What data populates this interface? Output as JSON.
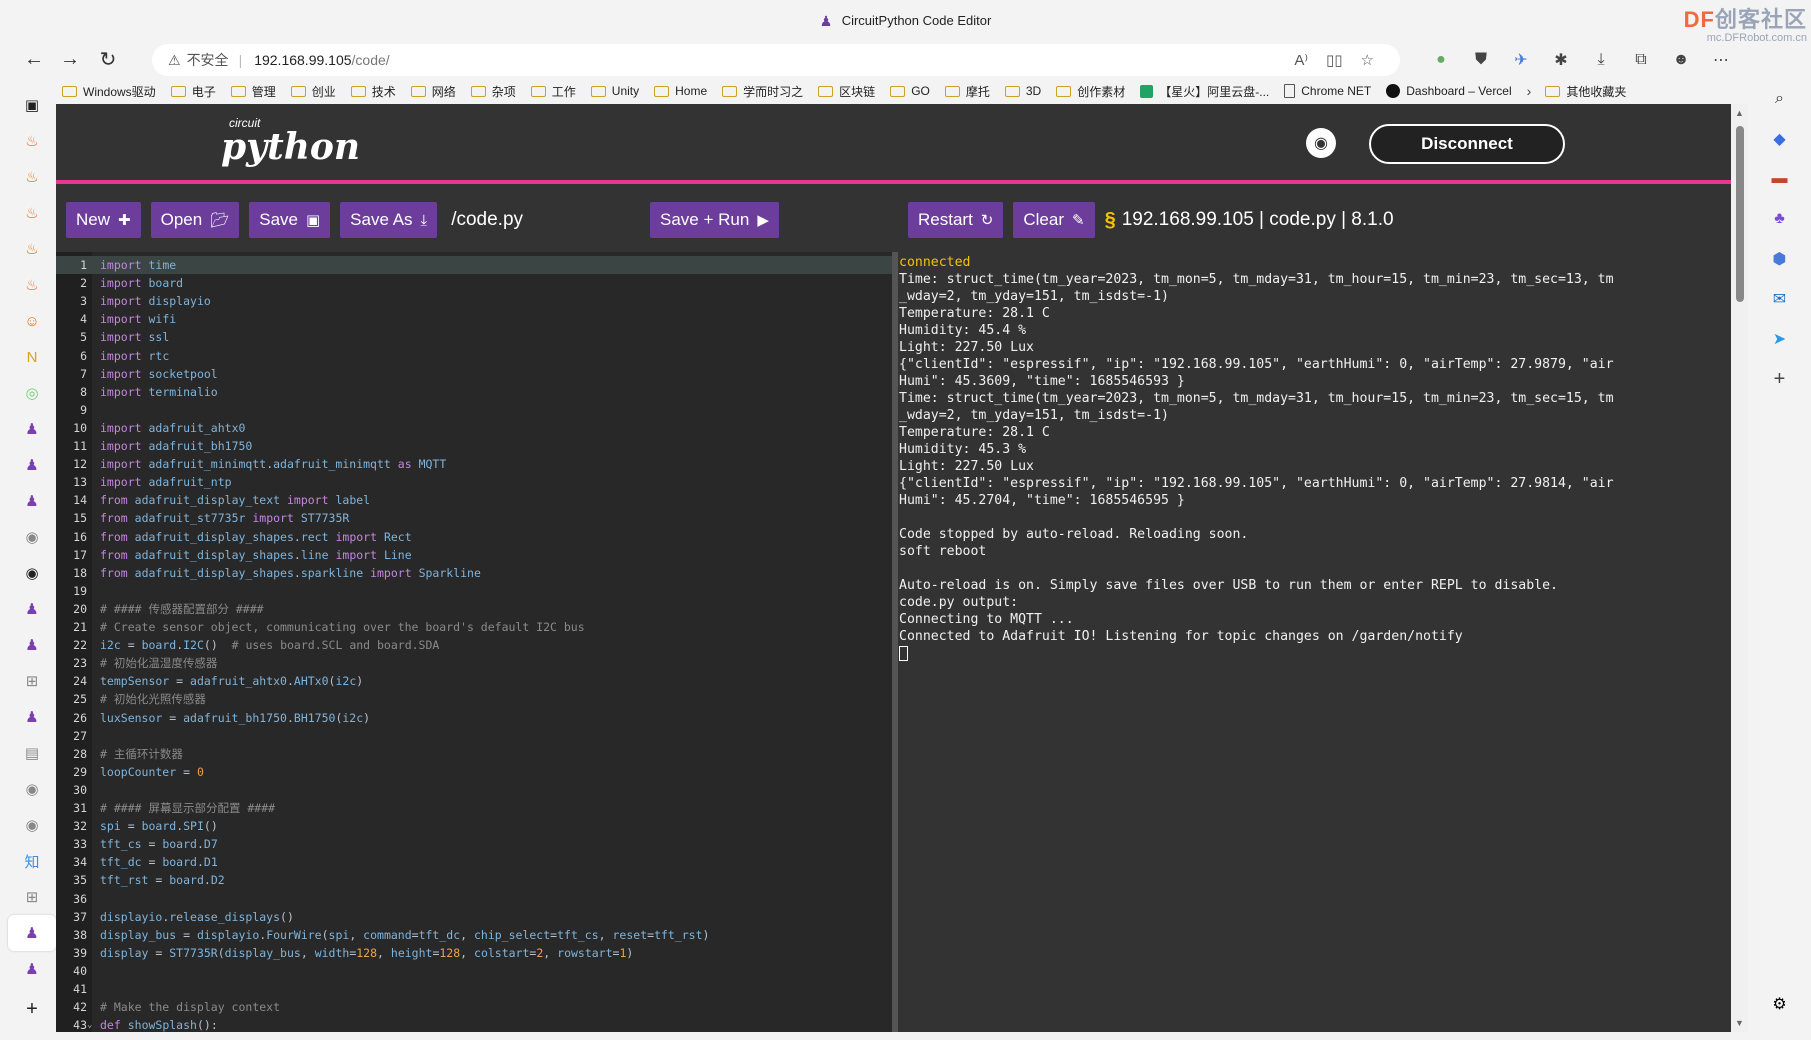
{
  "window": {
    "title": "CircuitPython Code Editor",
    "watermark_title_prefix": "DF",
    "watermark_title": "创客社区",
    "watermark_url": "mc.DFRobot.com.cn"
  },
  "addressbar": {
    "insecure_label": "不安全",
    "url_host": "192.168.99.105",
    "url_path": "/code/"
  },
  "bookmarks": [
    {
      "label": "Windows驱动",
      "icon": "folder"
    },
    {
      "label": "电子",
      "icon": "folder"
    },
    {
      "label": "管理",
      "icon": "folder"
    },
    {
      "label": "创业",
      "icon": "folder"
    },
    {
      "label": "技术",
      "icon": "folder"
    },
    {
      "label": "网络",
      "icon": "folder"
    },
    {
      "label": "杂项",
      "icon": "folder"
    },
    {
      "label": "工作",
      "icon": "folder"
    },
    {
      "label": "Unity",
      "icon": "folder"
    },
    {
      "label": "Home",
      "icon": "folder"
    },
    {
      "label": "学而时习之",
      "icon": "folder"
    },
    {
      "label": "区块链",
      "icon": "folder"
    },
    {
      "label": "GO",
      "icon": "folder"
    },
    {
      "label": "摩托",
      "icon": "folder"
    },
    {
      "label": "3D",
      "icon": "folder"
    },
    {
      "label": "创作素材",
      "icon": "folder"
    },
    {
      "label": "【星火】阿里云盘-...",
      "icon": "green"
    },
    {
      "label": "Chrome NET",
      "icon": "page"
    },
    {
      "label": "Dashboard – Vercel",
      "icon": "vercel"
    }
  ],
  "bookmarks_other": "其他收藏夹",
  "header": {
    "logo_small": "circuit",
    "logo_big": "python",
    "disconnect_label": "Disconnect"
  },
  "toolbar": {
    "new_label": "New",
    "open_label": "Open",
    "save_label": "Save",
    "save_as_label": "Save As",
    "filename": "/code.py",
    "save_run_label": "Save + Run",
    "restart_label": "Restart",
    "clear_label": "Clear",
    "connection_info": "192.168.99.105 | code.py | 8.1.0"
  },
  "editor": {
    "lines": [
      {
        "n": "1",
        "code": "import time"
      },
      {
        "n": "2",
        "code": "import board"
      },
      {
        "n": "3",
        "code": "import displayio"
      },
      {
        "n": "4",
        "code": "import wifi"
      },
      {
        "n": "5",
        "code": "import ssl"
      },
      {
        "n": "6",
        "code": "import rtc"
      },
      {
        "n": "7",
        "code": "import socketpool"
      },
      {
        "n": "8",
        "code": "import terminalio"
      },
      {
        "n": "9",
        "code": ""
      },
      {
        "n": "10",
        "code": "import adafruit_ahtx0"
      },
      {
        "n": "11",
        "code": "import adafruit_bh1750"
      },
      {
        "n": "12",
        "code": "import adafruit_minimqtt.adafruit_minimqtt as MQTT"
      },
      {
        "n": "13",
        "code": "import adafruit_ntp"
      },
      {
        "n": "14",
        "code": "from adafruit_display_text import label"
      },
      {
        "n": "15",
        "code": "from adafruit_st7735r import ST7735R"
      },
      {
        "n": "16",
        "code": "from adafruit_display_shapes.rect import Rect"
      },
      {
        "n": "17",
        "code": "from adafruit_display_shapes.line import Line"
      },
      {
        "n": "18",
        "code": "from adafruit_display_shapes.sparkline import Sparkline"
      },
      {
        "n": "19",
        "code": ""
      },
      {
        "n": "20",
        "code": "# #### 传感器配置部分 ####"
      },
      {
        "n": "21",
        "code": "# Create sensor object, communicating over the board's default I2C bus"
      },
      {
        "n": "22",
        "code": "i2c = board.I2C()  # uses board.SCL and board.SDA"
      },
      {
        "n": "23",
        "code": "# 初始化温湿度传感器"
      },
      {
        "n": "24",
        "code": "tempSensor = adafruit_ahtx0.AHTx0(i2c)"
      },
      {
        "n": "25",
        "code": "# 初始化光照传感器"
      },
      {
        "n": "26",
        "code": "luxSensor = adafruit_bh1750.BH1750(i2c)"
      },
      {
        "n": "27",
        "code": ""
      },
      {
        "n": "28",
        "code": "# 主循环计数器"
      },
      {
        "n": "29",
        "code": "loopCounter = 0"
      },
      {
        "n": "30",
        "code": ""
      },
      {
        "n": "31",
        "code": "# #### 屏幕显示部分配置 ####"
      },
      {
        "n": "32",
        "code": "spi = board.SPI()"
      },
      {
        "n": "33",
        "code": "tft_cs = board.D7"
      },
      {
        "n": "34",
        "code": "tft_dc = board.D1"
      },
      {
        "n": "35",
        "code": "tft_rst = board.D2"
      },
      {
        "n": "36",
        "code": ""
      },
      {
        "n": "37",
        "code": "displayio.release_displays()"
      },
      {
        "n": "38",
        "code": "display_bus = displayio.FourWire(spi, command=tft_dc, chip_select=tft_cs, reset=tft_rst)"
      },
      {
        "n": "39",
        "code": "display = ST7735R(display_bus, width=128, height=128, colstart=2, rowstart=1)"
      },
      {
        "n": "40",
        "code": ""
      },
      {
        "n": "41",
        "code": ""
      },
      {
        "n": "42",
        "code": "# Make the display context"
      },
      {
        "n": "43",
        "code": "def showSplash():"
      }
    ]
  },
  "serial": {
    "lines": [
      "connected",
      "Time: struct_time(tm_year=2023, tm_mon=5, tm_mday=31, tm_hour=15, tm_min=23, tm_sec=13, tm",
      "_wday=2, tm_yday=151, tm_isdst=-1)",
      "Temperature: 28.1 C",
      "Humidity: 45.4 %",
      "Light: 227.50 Lux",
      "{\"clientId\": \"espressif\", \"ip\": \"192.168.99.105\", \"earthHumi\": 0, \"airTemp\": 27.9879, \"air",
      "Humi\": 45.3609, \"time\": 1685546593 }",
      "Time: struct_time(tm_year=2023, tm_mon=5, tm_mday=31, tm_hour=15, tm_min=23, tm_sec=15, tm",
      "_wday=2, tm_yday=151, tm_isdst=-1)",
      "Temperature: 28.1 C",
      "Humidity: 45.3 %",
      "Light: 227.50 Lux",
      "{\"clientId\": \"espressif\", \"ip\": \"192.168.99.105\", \"earthHumi\": 0, \"airTemp\": 27.9814, \"air",
      "Humi\": 45.2704, \"time\": 1685546595 }",
      "",
      "Code stopped by auto-reload. Reloading soon.",
      "soft reboot",
      "",
      "Auto-reload is on. Simply save files over USB to run them or enter REPL to disable.",
      "code.py output:",
      "Connecting to MQTT ...",
      "Connected to Adafruit IO! Listening for topic changes on /garden/notify"
    ]
  }
}
